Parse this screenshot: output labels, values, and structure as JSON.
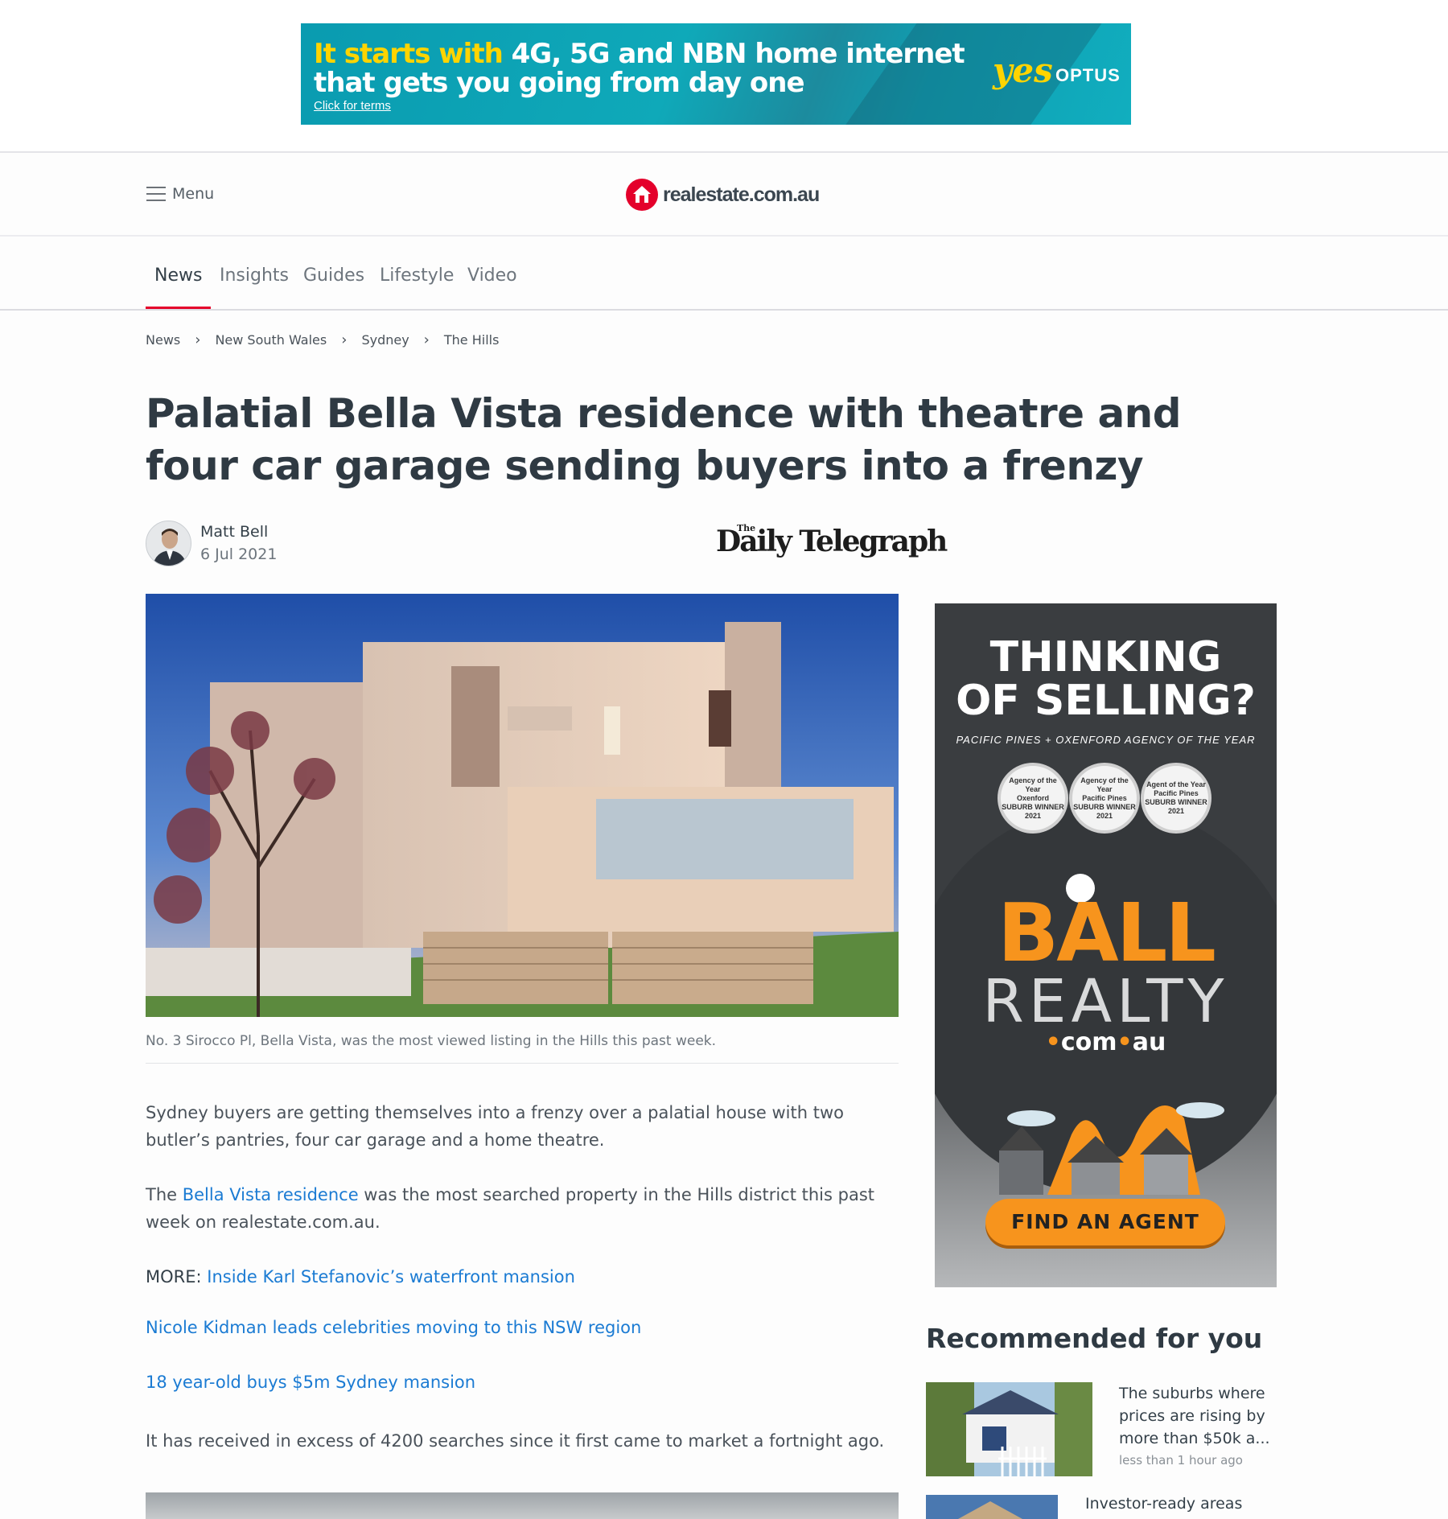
{
  "top_ad": {
    "line1_highlight": "It starts with",
    "line1_rest": "4G, 5G and NBN home internet",
    "line2": "that gets you going from day one",
    "terms": "Click for terms",
    "yes": "yes",
    "brand": "OPTUS"
  },
  "header": {
    "menu_label": "Menu",
    "logo_text": "realestate.com.au"
  },
  "nav": {
    "tabs": [
      {
        "label": "News",
        "active": true
      },
      {
        "label": "Insights"
      },
      {
        "label": "Guides"
      },
      {
        "label": "Lifestyle"
      },
      {
        "label": "Video"
      }
    ]
  },
  "breadcrumb": [
    "News",
    "New South Wales",
    "Sydney",
    "The Hills"
  ],
  "article": {
    "headline": "Palatial Bella Vista residence with theatre and four car garage sending buyers into a frenzy",
    "author": "Matt Bell",
    "date": "6 Jul 2021",
    "publisher_small": "The",
    "publisher": "Daily Telegraph",
    "caption": "No. 3 Sirocco Pl, Bella Vista, was the most viewed listing in the Hills this past week.",
    "para1": "Sydney buyers are getting themselves into a frenzy over a palatial house with two butler’s pantries, four car garage and a home theatre.",
    "para2_before": "The ",
    "para2_link": "Bella Vista residence",
    "para2_after": " was the most searched property in the Hills district this past week on realestate.com.au.",
    "more_label": "MORE: ",
    "more_link": "Inside Karl Stefanovic’s waterfront mansion",
    "link2": "Nicole Kidman leads celebrities moving to this NSW region",
    "link3": "18 year-old buys $5m Sydney mansion",
    "para3": "It has received in excess of 4200 searches since it first came to market a fortnight ago."
  },
  "side_ad": {
    "headline_1": "THINKING",
    "headline_2": "OF SELLING?",
    "sub": "PACIFIC PINES + OXENFORD AGENCY OF THE YEAR",
    "badges": [
      {
        "title": "Agency of the Year",
        "place": "Oxenford",
        "note": "SUBURB WINNER",
        "year": "2021"
      },
      {
        "title": "Agency of the Year",
        "place": "Pacific Pines",
        "note": "SUBURB WINNER",
        "year": "2021"
      },
      {
        "title": "Agent of the Year",
        "place": "Pacific Pines",
        "note": "SUBURB WINNER",
        "year": "2021"
      }
    ],
    "brand_1": "BALL",
    "brand_2": "REALTY",
    "brand_dot1": "•",
    "brand_com": "com",
    "brand_dot2": "•",
    "brand_au": "au",
    "cta": "FIND AN AGENT"
  },
  "recommended": {
    "title": "Recommended for you",
    "items": [
      {
        "title": "The suburbs where prices are rising by more than $50k a...",
        "time": "less than 1 hour ago"
      },
      {
        "title": "Investor-ready areas"
      }
    ]
  }
}
